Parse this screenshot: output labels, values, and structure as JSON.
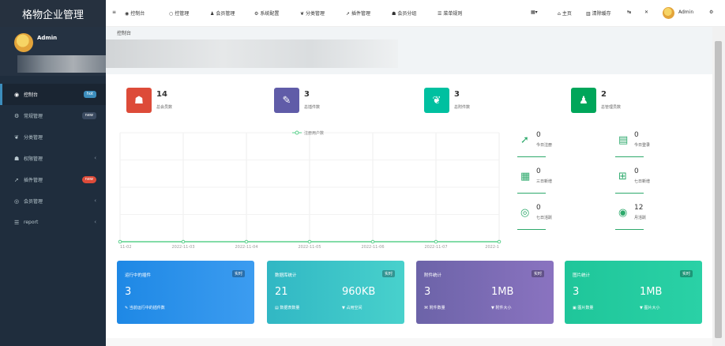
{
  "app": {
    "title": "格物企业管理"
  },
  "user": {
    "name": "Admin"
  },
  "nav": [
    {
      "label": "控制台",
      "badge": "hot",
      "icon": "dashboard-icon"
    },
    {
      "label": "常规管理",
      "badge": "new",
      "icon": "cogs-icon"
    },
    {
      "label": "分类管理",
      "icon": "leaf-icon"
    },
    {
      "label": "权限管理",
      "icon": "group-icon"
    },
    {
      "label": "插件管理",
      "badge": "new",
      "icon": "rocket-icon"
    },
    {
      "label": "会员管理",
      "icon": "user-circle-icon"
    },
    {
      "label": "report",
      "icon": "list-icon"
    }
  ],
  "topbar": {
    "items": [
      "控制台",
      "控管理",
      "会员管理",
      "系统配置",
      "分类管理",
      "插件管理",
      "会员分组",
      "菜单规则"
    ],
    "right": [
      "主页",
      "清除缓存"
    ],
    "admin": "Admin"
  },
  "breadcrumb": {
    "title": "控制台"
  },
  "stats": [
    {
      "value": "14",
      "label": "总会员数",
      "color": "#dd4b39"
    },
    {
      "value": "3",
      "label": "总插件数",
      "color": "#605ca8"
    },
    {
      "value": "3",
      "label": "总附件数",
      "color": "#00c0a0"
    },
    {
      "value": "2",
      "label": "总管理员数",
      "color": "#00a65a"
    }
  ],
  "chart_data": {
    "type": "line",
    "series": [
      {
        "name": "注册用户数",
        "values": [
          0,
          0,
          0,
          0,
          0,
          0,
          0
        ]
      }
    ],
    "categories": [
      "11-02",
      "2022-11-03",
      "2022-11-04",
      "2022-11-05",
      "2022-11-06",
      "2022-11-07",
      "2022-1"
    ],
    "ylim": [
      0,
      1
    ],
    "grid": true,
    "legend": "top"
  },
  "mini_stats": [
    {
      "value": "0",
      "label": "今日注册",
      "icon": "rocket-icon"
    },
    {
      "value": "0",
      "label": "今日登录",
      "icon": "id-card-icon"
    },
    {
      "value": "0",
      "label": "三日新增",
      "icon": "calendar-icon"
    },
    {
      "value": "0",
      "label": "七日新增",
      "icon": "calendar-plus-icon"
    },
    {
      "value": "0",
      "label": "七日活跃",
      "icon": "user-circle-icon"
    },
    {
      "value": "12",
      "label": "月活跃",
      "icon": "user-icon"
    }
  ],
  "cards": [
    {
      "title": "运行中的插件",
      "tag": "实时",
      "v1": "3",
      "v2": "",
      "s1": "当前运行中的插件数",
      "s2": ""
    },
    {
      "title": "数据库统计",
      "tag": "实时",
      "v1": "21",
      "v2": "960KB",
      "s1": "数据表数量",
      "s2": "占用空间"
    },
    {
      "title": "附件统计",
      "tag": "实时",
      "v1": "3",
      "v2": "1MB",
      "s1": "附件数量",
      "s2": "附件大小"
    },
    {
      "title": "图片统计",
      "tag": "实时",
      "v1": "3",
      "v2": "1MB",
      "s1": "图片数量",
      "s2": "图片大小"
    }
  ]
}
